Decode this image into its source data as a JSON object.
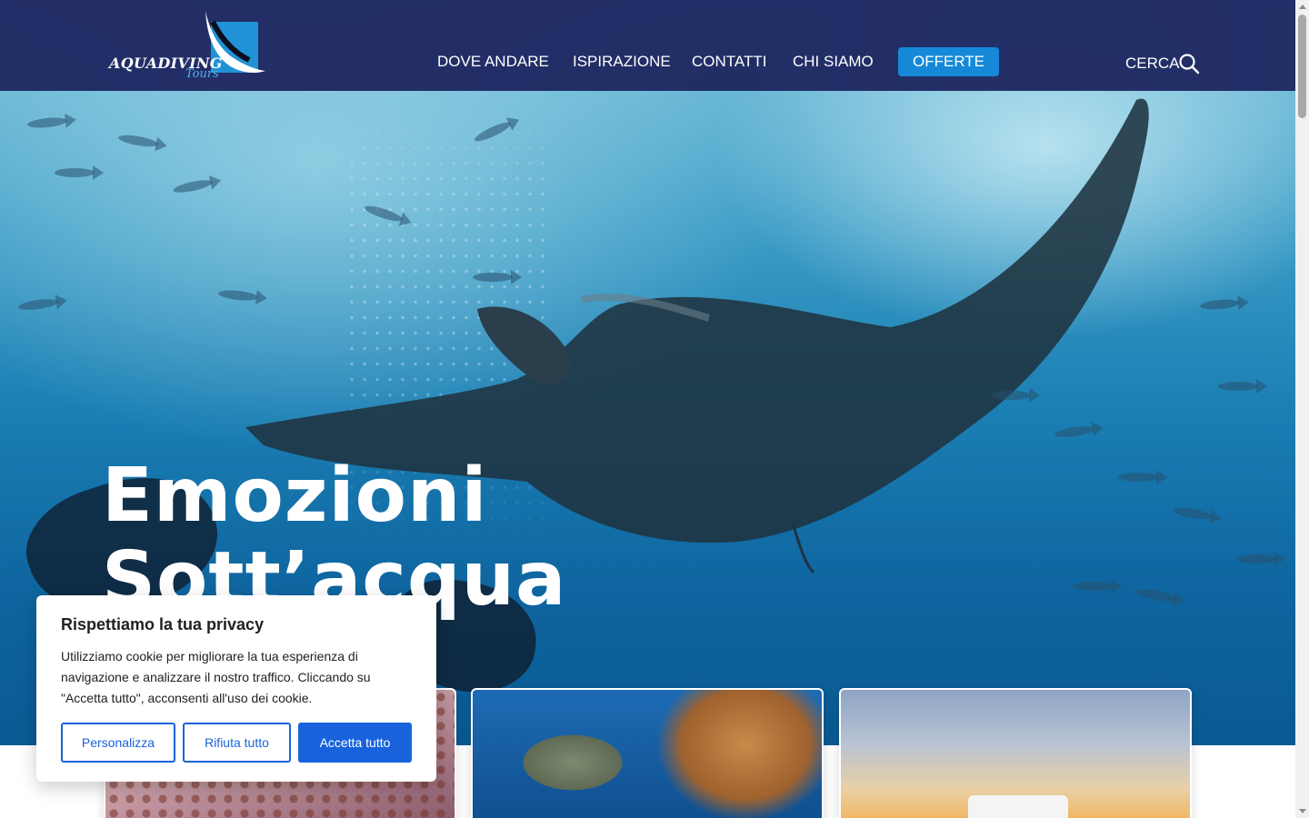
{
  "brand": {
    "name": "AQUADIVING",
    "sub": "Tours",
    "accent": "#2192d6",
    "header_bg": "#1e2660"
  },
  "nav": {
    "items": [
      {
        "label": "DOVE ANDARE"
      },
      {
        "label": "ISPIRAZIONE"
      },
      {
        "label": "CONTATTI"
      },
      {
        "label": "CHI SIAMO"
      },
      {
        "label": "OFFERTE"
      }
    ]
  },
  "search": {
    "label": "CERCA",
    "icon": "search-icon"
  },
  "hero": {
    "line1": "Emozioni",
    "line2": "Sott’acqua"
  },
  "cookie": {
    "title": "Rispettiamo la tua privacy",
    "text": "Utilizziamo cookie per migliorare la tua esperienza di navigazione e analizzare il nostro traffico. Cliccando su \"Accetta tutto\", acconsenti all'uso dei cookie.",
    "customize": "Personalizza",
    "reject": "Rifiuta tutto",
    "accept": "Accetta tutto",
    "button_color": "#1863dc"
  }
}
